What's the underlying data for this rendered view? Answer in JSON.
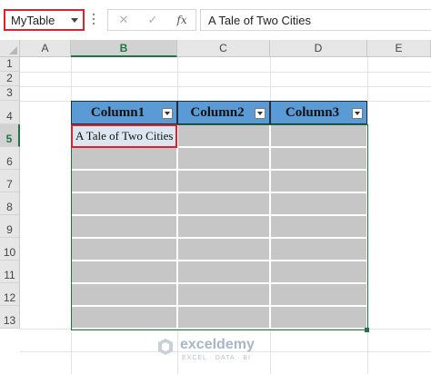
{
  "formula_bar": {
    "name_box": "MyTable",
    "cancel_glyph": "✕",
    "enter_glyph": "✓",
    "function_label": "fx",
    "content": "A Tale of Two Cities"
  },
  "columns": [
    "A",
    "B",
    "C",
    "D",
    "E"
  ],
  "rows": [
    "1",
    "2",
    "3",
    "4",
    "5",
    "6",
    "7",
    "8",
    "9",
    "10",
    "11",
    "12",
    "13"
  ],
  "selected": {
    "column": "B",
    "row": "5"
  },
  "table": {
    "headers": [
      "Column1",
      "Column2",
      "Column3"
    ],
    "cells": [
      [
        "A Tale of Two Cities",
        "",
        ""
      ],
      [
        "",
        "",
        ""
      ],
      [
        "",
        "",
        ""
      ],
      [
        "",
        "",
        ""
      ],
      [
        "",
        "",
        ""
      ],
      [
        "",
        "",
        ""
      ],
      [
        "",
        "",
        ""
      ],
      [
        "",
        "",
        ""
      ],
      [
        "",
        "",
        ""
      ]
    ]
  },
  "colors": {
    "header_fill": "#5b9bd5",
    "body_fill": "#c6c6c6",
    "active_cell_fill": "#dce6f0",
    "highlight_border": "#d9232e",
    "excel_green": "#217346"
  },
  "watermark": {
    "brand": "exceldemy",
    "tagline": "EXCEL · DATA · BI"
  }
}
